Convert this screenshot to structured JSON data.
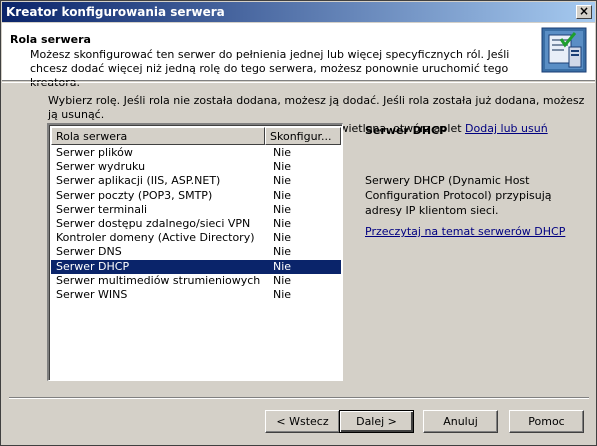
{
  "window": {
    "title": "Kreator konfigurowania serwera",
    "close_label": "×"
  },
  "header": {
    "title": "Rola serwera",
    "description": "Możesz skonfigurować ten serwer do pełnienia jednej lub więcej specyficznych ról. Jeśli chcesz dodać więcej niż jedną rolę do tego serwera, możesz ponownie uruchomić tego kreatora."
  },
  "intro": {
    "line1": "Wybierz rolę. Jeśli rola nie została dodana, możesz ją dodać. Jeśli rola została już dodana, możesz ją usunąć.",
    "line2_prefix": "Jeśli rola, którą chcesz dodać lub usunąć nie jest wyświetlona, otwórz aplet ",
    "link": "Dodaj lub usuń programy",
    "line2_suffix": "."
  },
  "roles_list": {
    "columns": [
      "Rola serwera",
      "Skonfigur..."
    ],
    "rows": [
      {
        "name": "Serwer plików",
        "state": "Nie"
      },
      {
        "name": "Serwer wydruku",
        "state": "Nie"
      },
      {
        "name": "Serwer aplikacji (IIS, ASP.NET)",
        "state": "Nie"
      },
      {
        "name": "Serwer poczty (POP3, SMTP)",
        "state": "Nie"
      },
      {
        "name": "Serwer terminali",
        "state": "Nie"
      },
      {
        "name": "Serwer dostępu zdalnego/sieci VPN",
        "state": "Nie"
      },
      {
        "name": "Kontroler domeny (Active Directory)",
        "state": "Nie"
      },
      {
        "name": "Serwer DNS",
        "state": "Nie"
      },
      {
        "name": "Serwer DHCP",
        "state": "Nie"
      },
      {
        "name": "Serwer multimediów strumieniowych",
        "state": "Nie"
      },
      {
        "name": "Serwer WINS",
        "state": "Nie"
      }
    ],
    "selected_index": 8
  },
  "detail": {
    "title": "Serwer DHCP",
    "description": "Serwery DHCP (Dynamic Host Configuration Protocol) przypisują adresy IP klientom sieci.",
    "link": "Przeczytaj na temat serwerów DHCP"
  },
  "buttons": {
    "back": "< Wstecz",
    "next": "Dalej >",
    "cancel": "Anuluj",
    "help": "Pomoc"
  },
  "icons": {
    "header_icon": "server-wizard-icon"
  },
  "colors": {
    "title_bar": "#0a246a",
    "selection": "#0a246a",
    "link": "#000080"
  }
}
